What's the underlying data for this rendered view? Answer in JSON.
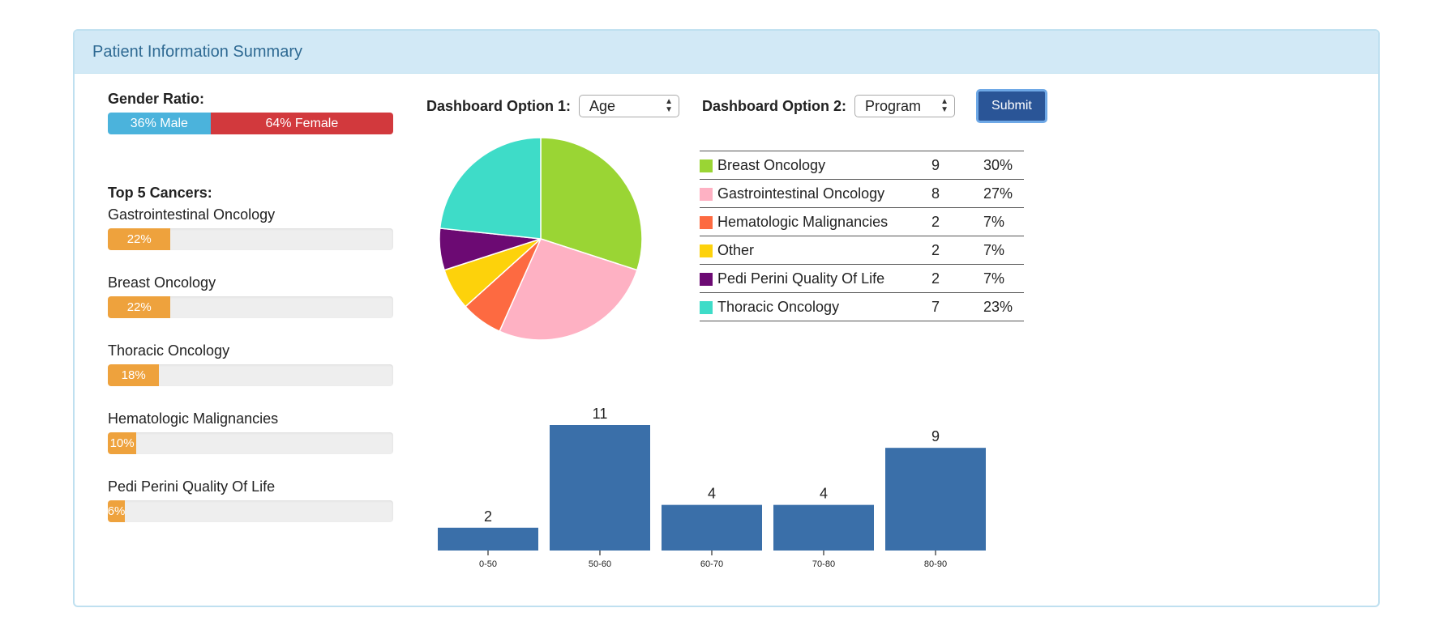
{
  "panel": {
    "title": "Patient Information Summary"
  },
  "gender": {
    "label": "Gender Ratio:",
    "male": {
      "text": "36% Male",
      "percent": 36,
      "color": "#4bb3dc"
    },
    "female": {
      "text": "64% Female",
      "percent": 64,
      "color": "#d2393d"
    }
  },
  "top_cancers": {
    "label": "Top 5 Cancers:",
    "bar_color": "#eea23d",
    "items": [
      {
        "name": "Gastrointestinal Oncology",
        "text": "22%",
        "percent": 22
      },
      {
        "name": "Breast Oncology",
        "text": "22%",
        "percent": 22
      },
      {
        "name": "Thoracic Oncology",
        "text": "18%",
        "percent": 18
      },
      {
        "name": "Hematologic Malignancies",
        "text": "10%",
        "percent": 10
      },
      {
        "name": "Pedi Perini Quality Of Life",
        "text": "6%",
        "percent": 6
      }
    ]
  },
  "controls": {
    "option1_label": "Dashboard Option 1:",
    "option1_value": "Age",
    "option2_label": "Dashboard Option 2:",
    "option2_value": "Program",
    "submit_label": "Submit"
  },
  "chart_data": [
    {
      "type": "pie",
      "title": "",
      "categories": [
        "Breast Oncology",
        "Gastrointestinal Oncology",
        "Hematologic Malignancies",
        "Other",
        "Pedi Perini Quality Of Life",
        "Thoracic Oncology"
      ],
      "values": [
        9,
        8,
        2,
        2,
        2,
        7
      ],
      "percents": [
        "30%",
        "27%",
        "7%",
        "7%",
        "7%",
        "23%"
      ],
      "counts": [
        "9",
        "8",
        "2",
        "2",
        "2",
        "7"
      ],
      "colors": [
        "#9ad534",
        "#feb1c3",
        "#fd6a41",
        "#fdd20b",
        "#6c0a73",
        "#3edcc8"
      ],
      "legend_position": "right"
    },
    {
      "type": "bar",
      "title": "",
      "categories": [
        "0-50",
        "50-60",
        "60-70",
        "70-80",
        "80-90"
      ],
      "values": [
        2,
        11,
        4,
        4,
        9
      ],
      "labels": [
        "2",
        "11",
        "4",
        "4",
        "9"
      ],
      "color": "#3a6fa9",
      "xlabel": "",
      "ylabel": "",
      "ylim": [
        0,
        11
      ]
    }
  ]
}
